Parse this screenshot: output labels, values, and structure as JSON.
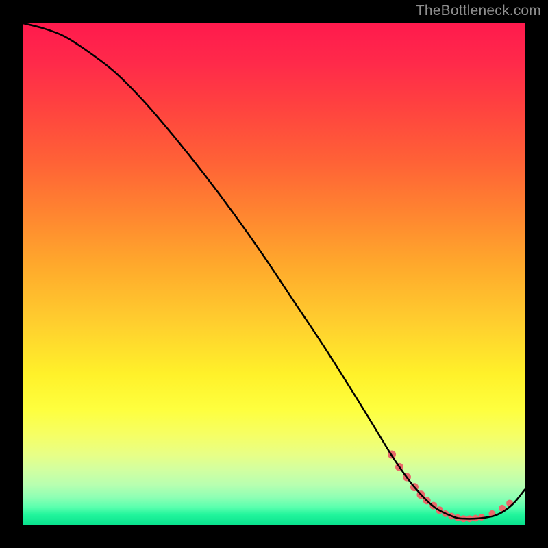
{
  "attribution": "TheBottleneck.com",
  "chart_data": {
    "type": "line",
    "title": "",
    "xlabel": "",
    "ylabel": "",
    "xlim": [
      0,
      100
    ],
    "ylim": [
      0,
      100
    ],
    "series": [
      {
        "name": "curve",
        "x": [
          0,
          4,
          8,
          12,
          18,
          24,
          30,
          36,
          42,
          48,
          54,
          60,
          66,
          70,
          74,
          78,
          82,
          86,
          88,
          90,
          92,
          94,
          96,
          98,
          100
        ],
        "y": [
          100,
          99,
          97.5,
          95,
          90.5,
          84.5,
          77.5,
          70,
          62,
          53.5,
          44.5,
          35.5,
          26,
          19.5,
          13,
          7.5,
          3.5,
          1.5,
          1.2,
          1.2,
          1.4,
          1.8,
          2.8,
          4.5,
          7
        ]
      }
    ],
    "markers": [
      {
        "x": 73.5,
        "y": 14.0,
        "r": 6
      },
      {
        "x": 75.0,
        "y": 11.5,
        "r": 6
      },
      {
        "x": 76.5,
        "y": 9.5,
        "r": 6
      },
      {
        "x": 78.0,
        "y": 7.5,
        "r": 6
      },
      {
        "x": 79.3,
        "y": 6.0,
        "r": 6
      },
      {
        "x": 80.5,
        "y": 4.8,
        "r": 5.5
      },
      {
        "x": 81.8,
        "y": 3.8,
        "r": 5.5
      },
      {
        "x": 83.0,
        "y": 2.9,
        "r": 5.5
      },
      {
        "x": 84.2,
        "y": 2.2,
        "r": 5
      },
      {
        "x": 85.4,
        "y": 1.7,
        "r": 5
      },
      {
        "x": 86.6,
        "y": 1.4,
        "r": 5
      },
      {
        "x": 87.8,
        "y": 1.2,
        "r": 5
      },
      {
        "x": 89.0,
        "y": 1.2,
        "r": 5
      },
      {
        "x": 90.2,
        "y": 1.3,
        "r": 5
      },
      {
        "x": 91.4,
        "y": 1.5,
        "r": 5
      },
      {
        "x": 93.5,
        "y": 2.2,
        "r": 5
      },
      {
        "x": 95.5,
        "y": 3.3,
        "r": 5
      },
      {
        "x": 97.0,
        "y": 4.3,
        "r": 5
      }
    ],
    "colors": {
      "curve": "#000000",
      "marker": "#e96a6a"
    }
  }
}
